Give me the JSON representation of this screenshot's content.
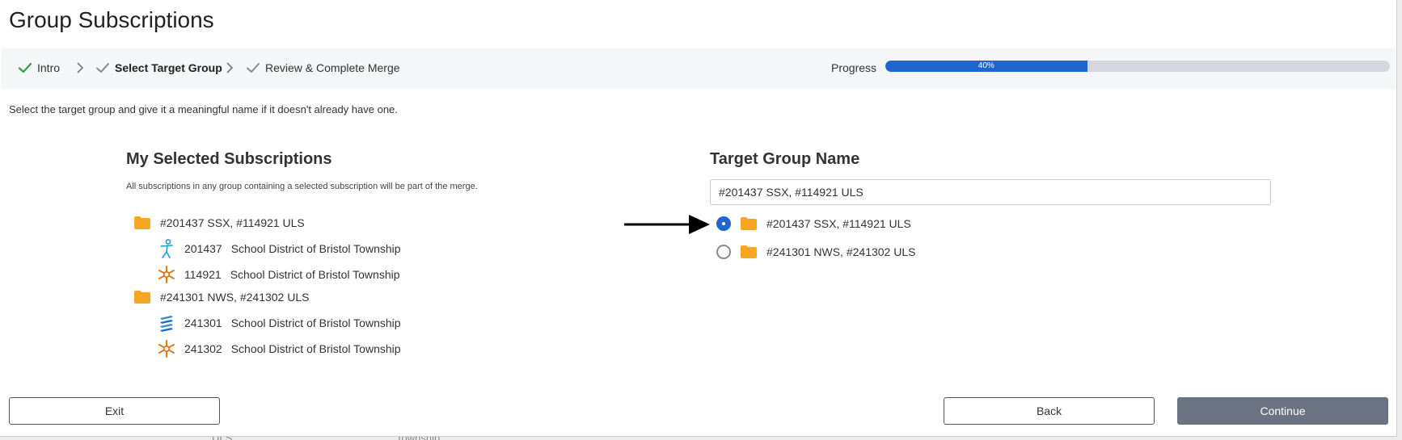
{
  "page": {
    "title": "Group Subscriptions"
  },
  "steps": [
    {
      "label": "Intro",
      "active": false
    },
    {
      "label": "Select Target Group",
      "active": true
    },
    {
      "label": "Review & Complete Merge",
      "active": false
    }
  ],
  "progress": {
    "label": "Progress",
    "value": 0.4,
    "text": "40%"
  },
  "instruction": "Select the target group and give it a meaningful name if it doesn't already have one.",
  "selected_subscriptions": {
    "heading": "My Selected Subscriptions",
    "note": "All subscriptions in any group containing a selected subscription will be part of the merge.",
    "groups": [
      {
        "name": "#201437 SSX, #114921 ULS",
        "items": [
          {
            "id": "201437",
            "name": "School District of Bristol Township",
            "icon": "person-icon"
          },
          {
            "id": "114921",
            "name": "School District of Bristol Township",
            "icon": "snowflake-icon"
          }
        ]
      },
      {
        "name": "#241301 NWS, #241302 ULS",
        "items": [
          {
            "id": "241301",
            "name": "School District of Bristol Township",
            "icon": "books-icon"
          },
          {
            "id": "241302",
            "name": "School District of Bristol Township",
            "icon": "snowflake-icon"
          }
        ]
      }
    ]
  },
  "target": {
    "heading": "Target Group Name",
    "input_value": "#201437 SSX, #114921 ULS",
    "options": [
      {
        "label": "#201437 SSX, #114921 ULS",
        "checked": true
      },
      {
        "label": "#241301 NWS, #241302 ULS",
        "checked": false
      }
    ]
  },
  "buttons": {
    "exit": "Exit",
    "back": "Back",
    "continue": "Continue"
  },
  "background_peek": {
    "left": "ULS",
    "right": "Township"
  },
  "colors": {
    "accent": "#1f66d1",
    "folder": "#f5a623",
    "check": "#2e9e4f",
    "primary_button": "#6b7383"
  }
}
